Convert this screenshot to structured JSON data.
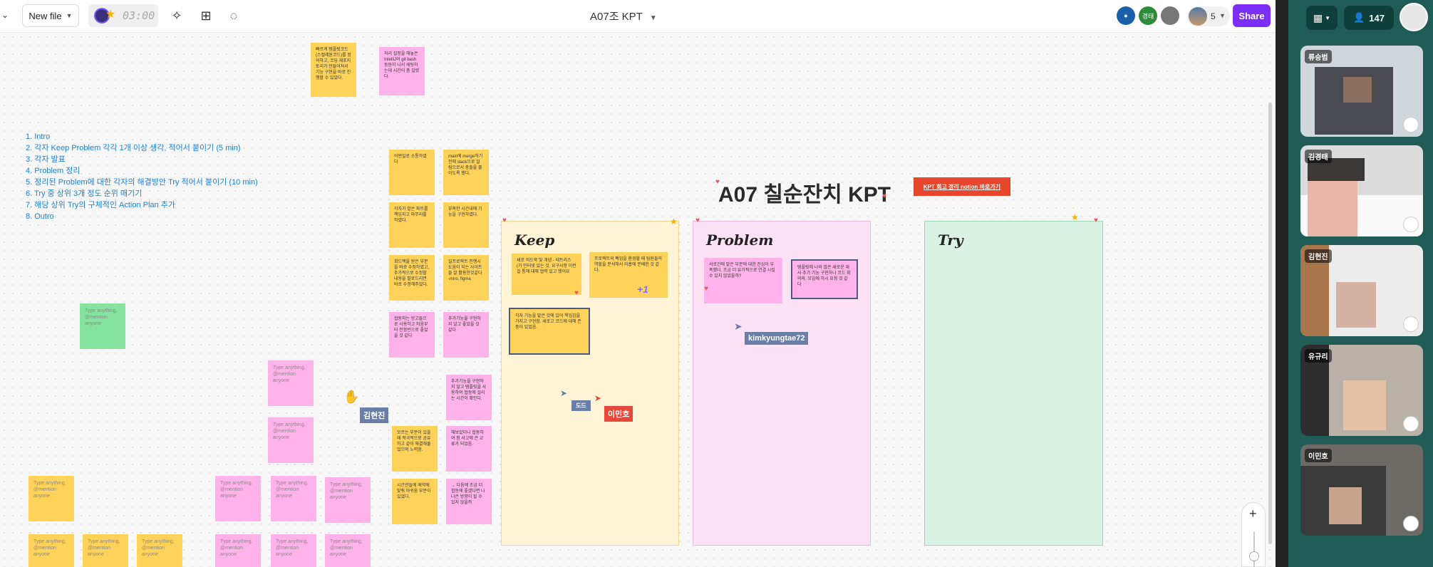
{
  "topbar": {
    "new_file_label": "New file",
    "timer": "03:00",
    "board_title": "A07조 KPT",
    "participant_badge": "경태",
    "extra_count": "5",
    "share_label": "Share"
  },
  "agenda": [
    "1. Intro",
    "2. 각자 Keep Problem 각각 1개 이상 생각, 적어서 붙이기 (5 min)",
    "3. 각자 발표",
    "4. Problem 정리",
    "5. 정리된 Problem에 대한 각자의 해결방안 Try 적어서 붙이기 (10 min)",
    "6. Try 중 상위 3개 정도 순위 매기기",
    "7. 해당 상위 Try의 구체적인 Action Plan 추가",
    "8. Outro"
  ],
  "board": {
    "main_title": "A07 칠순잔치 KPT",
    "notion_button": "KPT 회고 정리 notion 바로가기",
    "frames": {
      "keep": "Keep",
      "problem": "Problem",
      "try": "Try"
    }
  },
  "placeholder_text": "Type anything, @mention anyone",
  "notes_top": [
    "빠르게 템플릿코드(스켈레톤코드)를 정의하고, 코딩 재포지토리가 만들어져서 기능 구현을 바로 진행할 수 있었다.",
    "처리 설정을 해놓은 IntelliJ의 git bash 등등이 나서 세팅하는데 시간이 좀 걸렸다."
  ],
  "notes_mid": [
    "어쩐일로 소통하였다",
    "main에 merge하기 전에 slack으로 알림으로서 충돌을 줄이도록 했다.",
    "각자가 맡은 파트를 책임지고 마무리를 하였다.",
    "부족한 시간내에 기능을 구현하였다.",
    "회드백을 받은 부분을 바로 수정하였고, 추가적으로 수정할내용을 팔로드리면 바로 수정해주었다.",
    "일프로젝트 진행시 도움이 되는 사이트들 잘 활용한것같다 -miro, figma",
    "협동하는 방고들으로 사용하고 처음부터 전함반으로 좋았을 것 같다",
    "추가기능을 구현하지 않고 좋았을 것 같다",
    "추가기능을 구현하지 않고 템플릿을 사용하여 협동에 걸리는 시간이 확인다.",
    "모르는 부분이 있을 때 적극적으로 공유하고 같이 해결해줄 었으며 노력함.",
    "해보았더니 협동하여 뭔 사고에 큰 교류가 되었음.",
    "시간관들에 예약에 맞춰 아쉬움 부분이 있었다.",
    "→ 다음에 조금 더 협동에 좋겠다면 나 나은 방향이 될 수 있지 않을까"
  ],
  "keep_notes": [
    "새로 의드북 및 개념 - 테트리스(가 인터넷 있는 것, 요구사항 이런걸 통해 대해 협력 있고 했어요",
    "프로젝트의 팩업을 환경할 때 팀원들의 역할을 분석해서 미흡에 분배한 것 같다.",
    "각자 기능을 맡은 것에 있어 책임감을 가지고 구현함. 새로고 코드에 대해 존중이 있었음."
  ],
  "keep_plus": "+1",
  "problem_notes": [
    "서로간에 맡은 부분에 대한 진심이 부족했다. 조금 더 유기적으로 연결 시킬 수 있지 않았을까?",
    "템플릿에 나와 많은 새로운 재사 추가 기능 구현하나 코드 회의와, 모임에 하시 요청 것 같다"
  ],
  "cursors": [
    {
      "label": "kimkyungtae72",
      "color": "#6a7fa8"
    },
    {
      "label": "김현진",
      "color": "#6a7fa8"
    },
    {
      "label": "이민호",
      "color": "#e8473b"
    },
    {
      "label": "도드",
      "color": "#6a7fa8"
    }
  ],
  "zoom_icon": "+",
  "video_panel": {
    "participant_count": "147",
    "tiles": [
      "류승범",
      "김경태",
      "김현진",
      "유규리",
      "이민호"
    ]
  },
  "colors": {
    "share": "#7b2ff7",
    "notion_button": "#e8462c",
    "keep_bg": "#fff4d6",
    "problem_bg": "#fde2f5",
    "try_bg": "#d9f2e3",
    "agenda_text": "#1a82d6",
    "video_panel": "#1f5c55"
  }
}
